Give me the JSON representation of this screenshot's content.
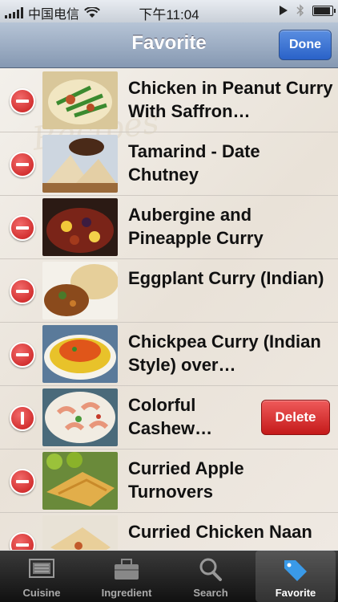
{
  "status_bar": {
    "carrier": "中国电信",
    "time": "下午11:04"
  },
  "nav": {
    "title": "Favorite",
    "done_label": "Done"
  },
  "list": {
    "watermark": "Recipes",
    "delete_label": "Delete",
    "items": [
      {
        "title": "Chicken in Peanut Curry With Saffron…"
      },
      {
        "title": "Tamarind - Date Chutney"
      },
      {
        "title": "Aubergine and Pineapple Curry"
      },
      {
        "title": "Eggplant Curry (Indian)"
      },
      {
        "title": "Chickpea Curry (Indian Style) over…"
      },
      {
        "title": "Colorful Cashew…"
      },
      {
        "title": "Curried Apple Turnovers"
      },
      {
        "title": "Curried Chicken Naan"
      }
    ]
  },
  "tabs": [
    {
      "label": "Cuisine",
      "icon": "cuisine-icon"
    },
    {
      "label": "Ingredient",
      "icon": "briefcase-icon"
    },
    {
      "label": "Search",
      "icon": "search-icon"
    },
    {
      "label": "Favorite",
      "icon": "tag-icon",
      "active": true
    }
  ],
  "colors": {
    "nav_top": "#b6c4d6",
    "nav_bottom": "#8598b2",
    "done": "#2a62c8",
    "delete": "#c41a1a"
  }
}
